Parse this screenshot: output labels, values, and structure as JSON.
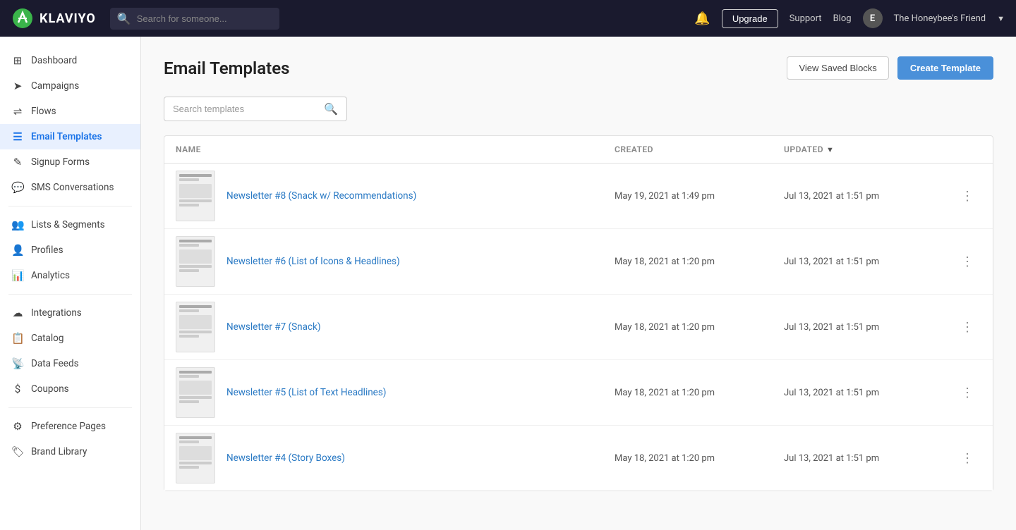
{
  "topnav": {
    "logo_text": "KLAVIYO",
    "search_placeholder": "Search for someone...",
    "upgrade_label": "Upgrade",
    "support_label": "Support",
    "blog_label": "Blog",
    "user_avatar": "E",
    "user_name": "The Honeybee's Friend"
  },
  "sidebar": {
    "items": [
      {
        "id": "dashboard",
        "label": "Dashboard",
        "icon": "⊞"
      },
      {
        "id": "campaigns",
        "label": "Campaigns",
        "icon": "➤"
      },
      {
        "id": "flows",
        "label": "Flows",
        "icon": "⇌"
      },
      {
        "id": "email-templates",
        "label": "Email Templates",
        "icon": "☰",
        "active": true
      },
      {
        "id": "signup-forms",
        "label": "Signup Forms",
        "icon": "✎"
      },
      {
        "id": "sms-conversations",
        "label": "SMS Conversations",
        "icon": "💬"
      },
      {
        "id": "lists-segments",
        "label": "Lists & Segments",
        "icon": "👥"
      },
      {
        "id": "profiles",
        "label": "Profiles",
        "icon": "👤"
      },
      {
        "id": "analytics",
        "label": "Analytics",
        "icon": "📊"
      },
      {
        "id": "integrations",
        "label": "Integrations",
        "icon": "☁"
      },
      {
        "id": "catalog",
        "label": "Catalog",
        "icon": "📋"
      },
      {
        "id": "data-feeds",
        "label": "Data Feeds",
        "icon": "📡"
      },
      {
        "id": "coupons",
        "label": "Coupons",
        "icon": "$"
      },
      {
        "id": "preference-pages",
        "label": "Preference Pages",
        "icon": "⚙"
      },
      {
        "id": "brand-library",
        "label": "Brand Library",
        "icon": "🏷"
      }
    ]
  },
  "page": {
    "title": "Email Templates",
    "view_saved_blocks_label": "View Saved Blocks",
    "create_template_label": "Create Template",
    "search_placeholder": "Search templates",
    "table": {
      "headers": {
        "name": "Name",
        "created": "Created",
        "updated": "Updated"
      },
      "rows": [
        {
          "name": "Newsletter #8 (Snack w/ Recommendations)",
          "created": "May 19, 2021 at 1:49 pm",
          "updated": "Jul 13, 2021 at 1:51 pm"
        },
        {
          "name": "Newsletter #6 (List of Icons & Headlines)",
          "created": "May 18, 2021 at 1:20 pm",
          "updated": "Jul 13, 2021 at 1:51 pm"
        },
        {
          "name": "Newsletter #7 (Snack)",
          "created": "May 18, 2021 at 1:20 pm",
          "updated": "Jul 13, 2021 at 1:51 pm"
        },
        {
          "name": "Newsletter #5 (List of Text Headlines)",
          "created": "May 18, 2021 at 1:20 pm",
          "updated": "Jul 13, 2021 at 1:51 pm"
        },
        {
          "name": "Newsletter #4 (Story Boxes)",
          "created": "May 18, 2021 at 1:20 pm",
          "updated": "Jul 13, 2021 at 1:51 pm"
        }
      ]
    }
  }
}
